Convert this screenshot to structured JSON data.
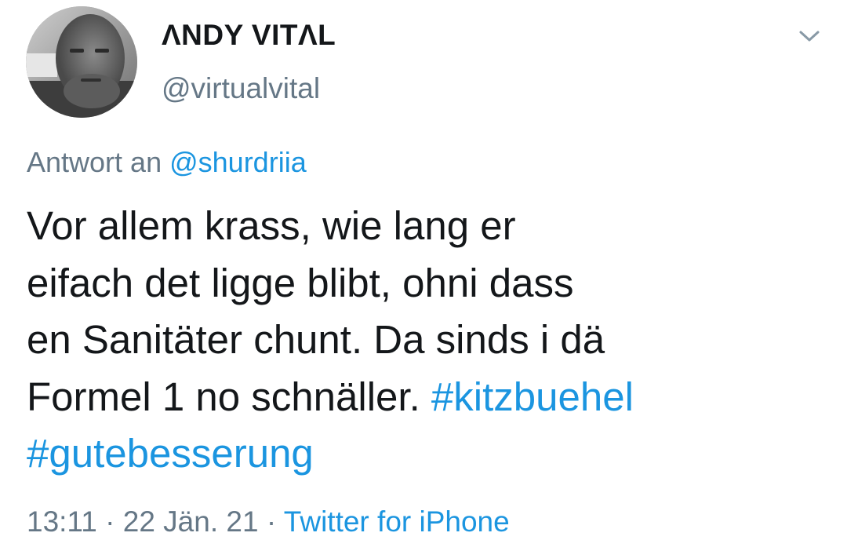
{
  "author": {
    "display_name": "ΛNDY VITΛL",
    "handle": "@virtualvital"
  },
  "icons": {
    "avatar": "profile-photo",
    "menu": "chevron-down-icon"
  },
  "reply": {
    "prefix": "Antwort an",
    "mention": "@shurdriia"
  },
  "tweet": {
    "lines": [
      "Vor allem krass, wie lang er",
      "eifach det ligge blibt, ohni dass",
      "en Sanitäter chunt. Da sinds i dä",
      "Formel 1 no schnäller."
    ],
    "hashtags": [
      "#kitzbuehel",
      "#gutebesserung"
    ]
  },
  "meta": {
    "time": "13:11",
    "date": "22 Jän. 21",
    "separator": "·",
    "source": "Twitter for iPhone"
  },
  "colors": {
    "text": "#14171a",
    "secondary": "#657786",
    "link": "#1b95e0",
    "background": "#ffffff"
  }
}
